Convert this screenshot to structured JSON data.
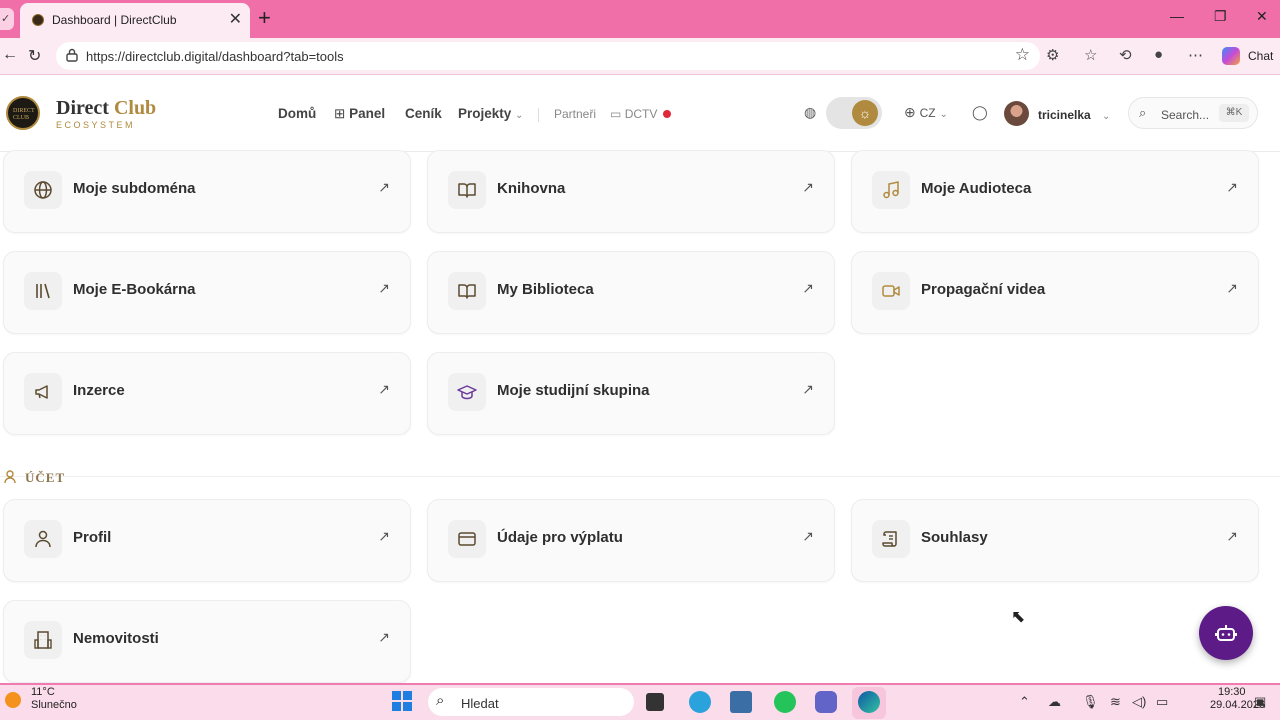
{
  "browser": {
    "corner_label": "✓",
    "tab_title": "Dashboard | DirectClub",
    "tab_close": "✕",
    "new_tab": "+",
    "url": "https://directclub.digital/dashboard?tab=tools",
    "chat_label": "Chat",
    "minimize": "—",
    "restore": "❐",
    "close": "✕"
  },
  "site": {
    "logo_name_1": "Direct",
    "logo_name_2": "Club",
    "logo_sub": "ECOSYSTEM",
    "badge_text": "DIRECT CLUB",
    "nav": {
      "home": "Domů",
      "panel": "Panel",
      "pricing": "Ceník",
      "projects": "Projekty",
      "partners": "Partneři",
      "dctv": "DCTV"
    },
    "language": "CZ",
    "username": "tricinelka",
    "search_placeholder": "Search...",
    "search_shortcut": "⌘K"
  },
  "tools": [
    {
      "label": "Moje subdoména",
      "icon": "globe-icon"
    },
    {
      "label": "Knihovna",
      "icon": "book-open-icon"
    },
    {
      "label": "Moje Audioteca",
      "icon": "music-icon"
    },
    {
      "label": "Moje E-Bookárna",
      "icon": "library-icon"
    },
    {
      "label": "My Biblioteca",
      "icon": "book-open-icon"
    },
    {
      "label": "Propagační videa",
      "icon": "video-icon"
    },
    {
      "label": "Inzerce",
      "icon": "megaphone-icon"
    },
    {
      "label": "Moje studijní skupina",
      "icon": "graduation-cap-icon"
    }
  ],
  "account_section": {
    "title": "ÚČET",
    "items": [
      {
        "label": "Profil",
        "icon": "user-icon"
      },
      {
        "label": "Údaje pro výplatu",
        "icon": "credit-card-icon"
      },
      {
        "label": "Souhlasy",
        "icon": "scroll-icon"
      },
      {
        "label": "Nemovitosti",
        "icon": "building-icon"
      }
    ]
  },
  "taskbar": {
    "temperature": "11°C",
    "weather": "Slunečno",
    "search_label": "Hledat",
    "time": "19:30",
    "date": "29.04.2026"
  },
  "colors": {
    "accent": "#b08a3e",
    "tabbar": "#f06fa8",
    "fab": "#5d1b87",
    "dctv_dot": "#e0283a"
  }
}
